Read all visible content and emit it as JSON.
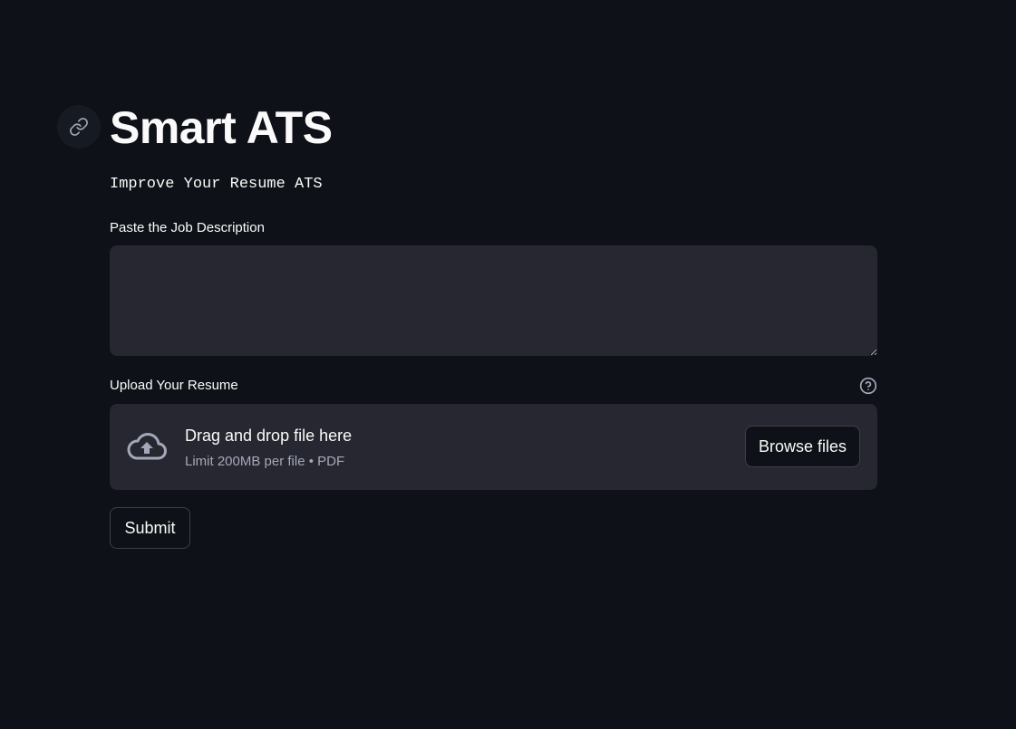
{
  "header": {
    "title": "Smart ATS",
    "subtitle": "Improve Your Resume ATS",
    "anchor_icon": "link-icon"
  },
  "job_description": {
    "label": "Paste the Job Description",
    "value": "",
    "placeholder": ""
  },
  "resume_upload": {
    "label": "Upload Your Resume",
    "help_icon": "question-circle-icon",
    "upload_icon": "cloud-upload-icon",
    "drop_text": "Drag and drop file here",
    "limit_text": "Limit 200MB per file • PDF",
    "browse_label": "Browse files"
  },
  "actions": {
    "submit_label": "Submit"
  },
  "colors": {
    "background": "#0e1117",
    "input_background": "#262730",
    "text": "#fafafa",
    "muted_text": "#a3a8b8"
  }
}
